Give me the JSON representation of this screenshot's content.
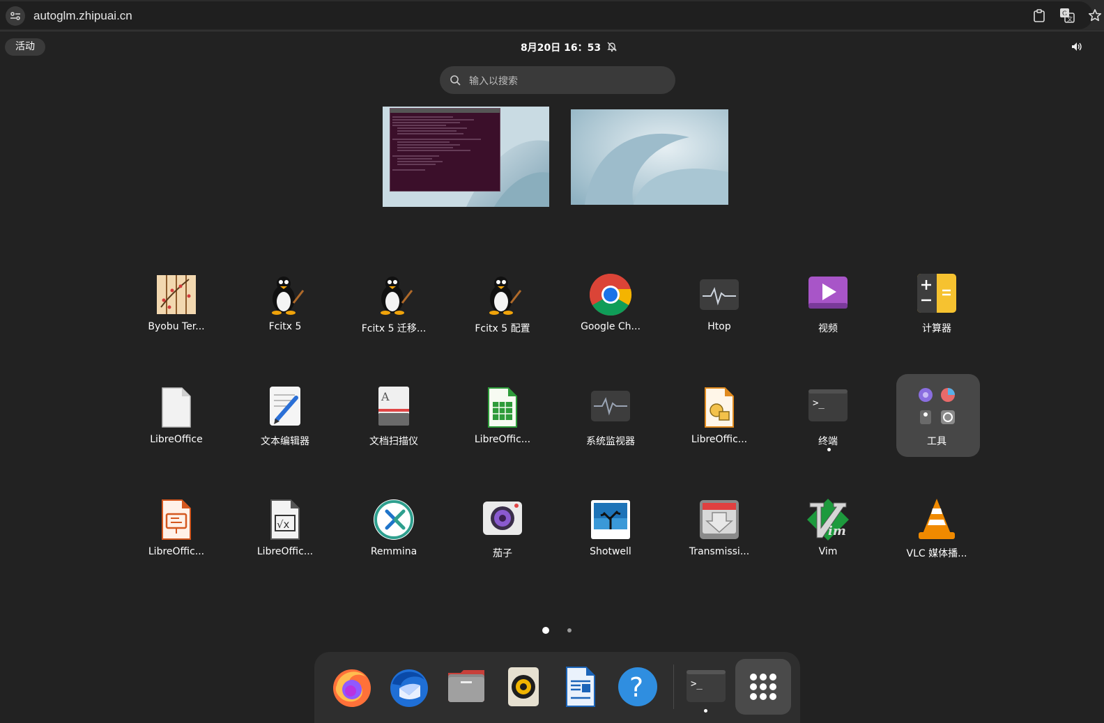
{
  "browser": {
    "url": "autoglm.zhipuai.cn"
  },
  "panel": {
    "activities": "活动",
    "clock": "8月20日  16：53"
  },
  "search": {
    "placeholder": "输入以搜索"
  },
  "apps": [
    {
      "label": "Byobu Ter...",
      "icon": "byobu-icon"
    },
    {
      "label": "Fcitx 5",
      "icon": "tux-icon"
    },
    {
      "label": "Fcitx 5 迁移...",
      "icon": "tux-icon"
    },
    {
      "label": "Fcitx 5 配置",
      "icon": "tux-icon"
    },
    {
      "label": "Google Ch...",
      "icon": "chrome-icon"
    },
    {
      "label": "Htop",
      "icon": "htop-icon"
    },
    {
      "label": "视频",
      "icon": "video-icon"
    },
    {
      "label": "计算器",
      "icon": "calculator-icon"
    },
    {
      "label": "LibreOffice",
      "icon": "libreoffice-icon"
    },
    {
      "label": "文本编辑器",
      "icon": "text-editor-icon"
    },
    {
      "label": "文档扫描仪",
      "icon": "scanner-icon"
    },
    {
      "label": "LibreOffic...",
      "icon": "calc-icon"
    },
    {
      "label": "系统监视器",
      "icon": "system-monitor-icon"
    },
    {
      "label": "LibreOffic...",
      "icon": "draw-icon"
    },
    {
      "label": "终端",
      "icon": "terminal-icon"
    },
    {
      "label": "工具",
      "icon": "tools-folder-icon"
    },
    {
      "label": "LibreOffic...",
      "icon": "impress-icon"
    },
    {
      "label": "LibreOffic...",
      "icon": "math-icon"
    },
    {
      "label": "Remmina",
      "icon": "remmina-icon"
    },
    {
      "label": "茄子",
      "icon": "cheese-icon"
    },
    {
      "label": "Shotwell",
      "icon": "shotwell-icon"
    },
    {
      "label": "Transmissi...",
      "icon": "transmission-icon"
    },
    {
      "label": "Vim",
      "icon": "vim-icon"
    },
    {
      "label": "VLC 媒体播...",
      "icon": "vlc-icon"
    }
  ],
  "pager": {
    "current_page": 1,
    "total_pages": 2
  },
  "dock": [
    "firefox-icon",
    "thunderbird-icon",
    "files-icon",
    "rhythmbox-icon",
    "writer-icon",
    "help-icon",
    "terminal-icon",
    "show-apps-icon"
  ],
  "colors": {
    "background": "#222222",
    "accent_chrome_blue": "#1a73e8",
    "folder_bg": "#474747"
  }
}
